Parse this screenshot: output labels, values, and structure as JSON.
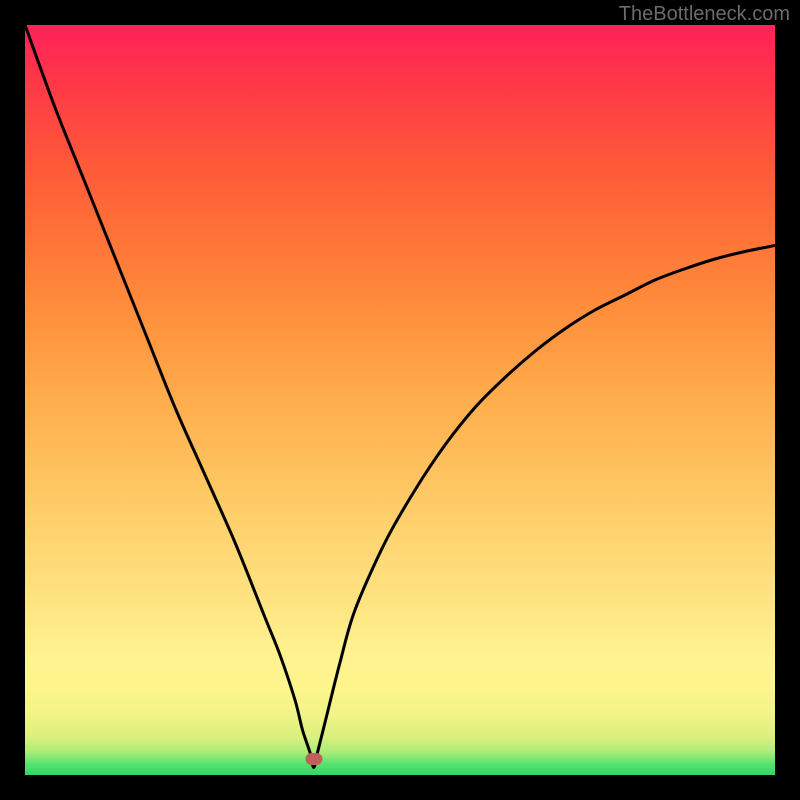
{
  "attribution": "TheBottleneck.com",
  "colors": {
    "curve_stroke": "#000000",
    "marker_fill": "#c06058",
    "frame": "#000000"
  },
  "marker": {
    "x_pct": 38.5,
    "y_pct": 97.9
  },
  "chart_data": {
    "type": "line",
    "title": "",
    "xlabel": "",
    "ylabel": "",
    "xlim": [
      0,
      100
    ],
    "ylim": [
      0,
      100
    ],
    "series": [
      {
        "name": "bottleneck-curve",
        "x": [
          0,
          4,
          8,
          12,
          16,
          20,
          24,
          28,
          32,
          34,
          36,
          37,
          38,
          38.5,
          39,
          40,
          42,
          44,
          48,
          52,
          56,
          60,
          64,
          68,
          72,
          76,
          80,
          84,
          88,
          92,
          96,
          100
        ],
        "y": [
          100,
          89,
          79,
          69,
          59,
          49,
          40,
          31,
          21,
          16,
          10,
          6,
          3,
          1,
          3,
          7,
          15,
          22,
          31,
          38,
          44,
          49,
          53,
          56.5,
          59.5,
          62,
          64,
          66,
          67.5,
          68.8,
          69.8,
          70.6
        ]
      }
    ],
    "annotations": [
      {
        "type": "marker",
        "x": 38.5,
        "y": 2.1,
        "label": "optimal-point"
      }
    ],
    "grid": false,
    "legend": false
  }
}
